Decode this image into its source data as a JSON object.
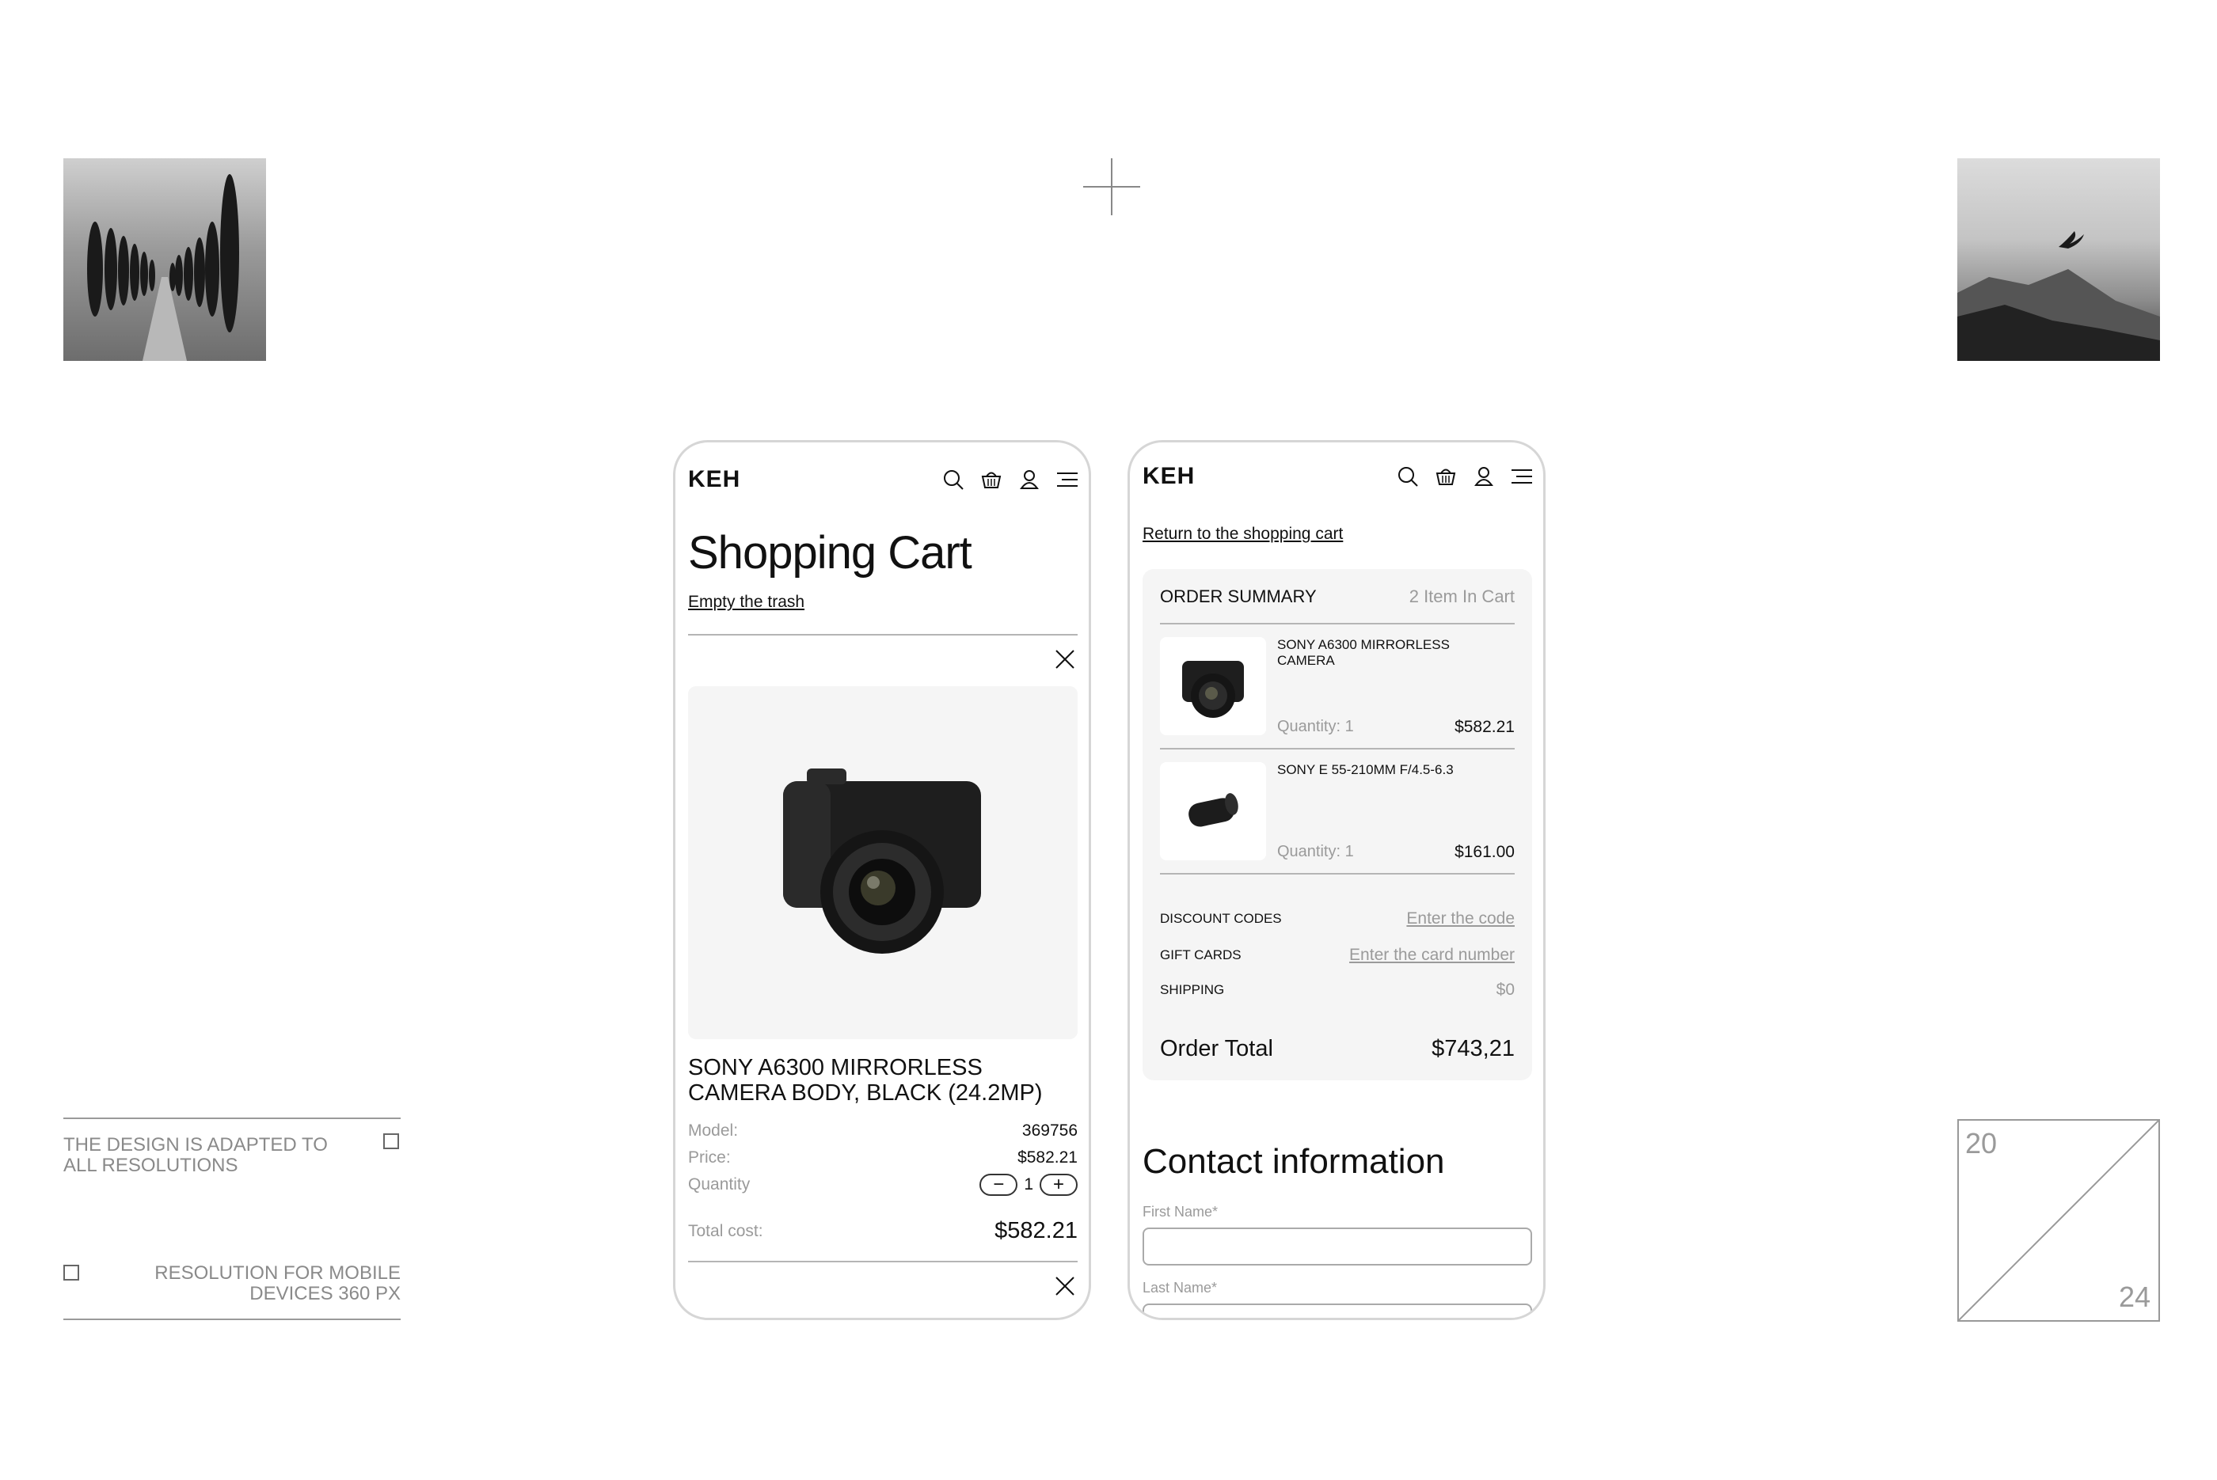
{
  "side_notes": {
    "top": "THE DESIGN IS ADAPTED TO ALL RESOLUTIONS",
    "bottom": "RESOLUTION FOR MOBILE DEVICES 360 PX"
  },
  "counter": {
    "start": "20",
    "end": "24"
  },
  "icons": {
    "search": "search-icon",
    "basket": "basket-icon",
    "user": "user-icon",
    "menu": "menu-icon",
    "close": "close-icon"
  },
  "cart_screen": {
    "logo": "KEH",
    "title": "Shopping Cart",
    "empty_link": "Empty the trash",
    "product": {
      "name": "SONY A6300 MIRRORLESS CAMERA BODY, BLACK (24.2MP)",
      "model_label": "Model:",
      "model_value": "369756",
      "price_label": "Price:",
      "price_value": "$582.21",
      "quantity_label": "Quantity",
      "quantity_value": "1",
      "minus": "−",
      "plus": "+",
      "total_label": "Total cost:",
      "total_value": "$582.21"
    }
  },
  "checkout_screen": {
    "logo": "KEH",
    "return_link": "Return to the shopping cart",
    "summary": {
      "title": "ORDER SUMMARY",
      "count": "2 Item In Cart",
      "items": [
        {
          "name": "SONY A6300 MIRRORLESS CAMERA",
          "quantity": "Quantity: 1",
          "price": "$582.21"
        },
        {
          "name": "SONY E 55-210MM F/4.5-6.3",
          "quantity": "Quantity: 1",
          "price": "$161.00"
        }
      ],
      "discount_label": "DISCOUNT CODES",
      "discount_value": "Enter the code",
      "gift_label": "GIFT CARDS",
      "gift_value": "Enter the card number",
      "shipping_label": "SHIPPING",
      "shipping_value": "$0",
      "total_label": "Order Total",
      "total_value": "$743,21"
    },
    "contact": {
      "title": "Contact information",
      "first_name_label": "First Name*",
      "last_name_label": "Last Name*"
    }
  }
}
